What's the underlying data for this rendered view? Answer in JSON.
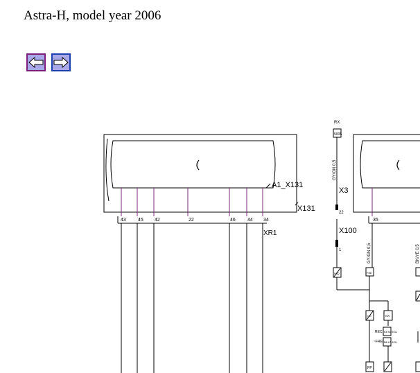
{
  "header": {
    "title": "Astra-H, model year 2006"
  },
  "nav": {
    "back_icon": "arrow-left-icon",
    "forward_icon": "arrow-right-icon"
  },
  "diagram": {
    "left_connector": "A1_X131",
    "left_block_label": "X131",
    "left_pins": [
      "43",
      "45",
      "42",
      "22",
      "46",
      "44",
      "34"
    ],
    "xr1_label": "XR1",
    "wire_top_code": "RX",
    "ground_box": "5005",
    "wire_color_vertical": "GY/GN 0,5",
    "x3_label": "X3",
    "x3_pin": "22",
    "x100_label": "X100",
    "x100_pin": "1",
    "right_pin": "35",
    "right_wire_color_1": "GY/GN 0,5",
    "right_wire_color_2": "BK/YE 0,5",
    "fuse_1": "F8D",
    "fuse_2": "F8D",
    "box_kw": "KW",
    "box_kw_small": "K/W",
    "row1_labels": [
      "REC",
      "K8 N4",
      "K3L"
    ],
    "row2_labels": [
      "~FREI",
      "B8 K3",
      "K3L"
    ],
    "box_pp": "PP"
  }
}
